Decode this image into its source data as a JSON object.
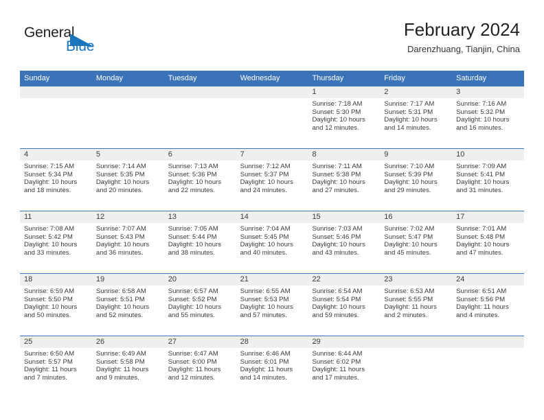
{
  "brand": {
    "name_top": "General",
    "name_bottom": "Blue",
    "flag_icon": "blue-triangle-flag-icon",
    "flag_color": "#1b75bc",
    "text_color": "#231f20"
  },
  "header": {
    "title": "February 2024",
    "subtitle": "Darenzhuang, Tianjin, China"
  },
  "theme": {
    "header_blue": "#3b73b8",
    "datestrip_gray": "#efeff0",
    "cell_white": "#ffffff",
    "text": "#3a3a3a"
  },
  "calendar": {
    "weekday_headers": [
      "Sunday",
      "Monday",
      "Tuesday",
      "Wednesday",
      "Thursday",
      "Friday",
      "Saturday"
    ],
    "labels": {
      "sunrise": "Sunrise:",
      "sunset": "Sunset:",
      "daylight": "Daylight:"
    },
    "weeks": [
      [
        {
          "day": "",
          "sunrise": "",
          "sunset": "",
          "daylight_line1": "",
          "daylight_line2": ""
        },
        {
          "day": "",
          "sunrise": "",
          "sunset": "",
          "daylight_line1": "",
          "daylight_line2": ""
        },
        {
          "day": "",
          "sunrise": "",
          "sunset": "",
          "daylight_line1": "",
          "daylight_line2": ""
        },
        {
          "day": "",
          "sunrise": "",
          "sunset": "",
          "daylight_line1": "",
          "daylight_line2": ""
        },
        {
          "day": "1",
          "sunrise": "Sunrise: 7:18 AM",
          "sunset": "Sunset: 5:30 PM",
          "daylight_line1": "Daylight: 10 hours",
          "daylight_line2": "and 12 minutes."
        },
        {
          "day": "2",
          "sunrise": "Sunrise: 7:17 AM",
          "sunset": "Sunset: 5:31 PM",
          "daylight_line1": "Daylight: 10 hours",
          "daylight_line2": "and 14 minutes."
        },
        {
          "day": "3",
          "sunrise": "Sunrise: 7:16 AM",
          "sunset": "Sunset: 5:32 PM",
          "daylight_line1": "Daylight: 10 hours",
          "daylight_line2": "and 16 minutes."
        }
      ],
      [
        {
          "day": "4",
          "sunrise": "Sunrise: 7:15 AM",
          "sunset": "Sunset: 5:34 PM",
          "daylight_line1": "Daylight: 10 hours",
          "daylight_line2": "and 18 minutes."
        },
        {
          "day": "5",
          "sunrise": "Sunrise: 7:14 AM",
          "sunset": "Sunset: 5:35 PM",
          "daylight_line1": "Daylight: 10 hours",
          "daylight_line2": "and 20 minutes."
        },
        {
          "day": "6",
          "sunrise": "Sunrise: 7:13 AM",
          "sunset": "Sunset: 5:36 PM",
          "daylight_line1": "Daylight: 10 hours",
          "daylight_line2": "and 22 minutes."
        },
        {
          "day": "7",
          "sunrise": "Sunrise: 7:12 AM",
          "sunset": "Sunset: 5:37 PM",
          "daylight_line1": "Daylight: 10 hours",
          "daylight_line2": "and 24 minutes."
        },
        {
          "day": "8",
          "sunrise": "Sunrise: 7:11 AM",
          "sunset": "Sunset: 5:38 PM",
          "daylight_line1": "Daylight: 10 hours",
          "daylight_line2": "and 27 minutes."
        },
        {
          "day": "9",
          "sunrise": "Sunrise: 7:10 AM",
          "sunset": "Sunset: 5:39 PM",
          "daylight_line1": "Daylight: 10 hours",
          "daylight_line2": "and 29 minutes."
        },
        {
          "day": "10",
          "sunrise": "Sunrise: 7:09 AM",
          "sunset": "Sunset: 5:41 PM",
          "daylight_line1": "Daylight: 10 hours",
          "daylight_line2": "and 31 minutes."
        }
      ],
      [
        {
          "day": "11",
          "sunrise": "Sunrise: 7:08 AM",
          "sunset": "Sunset: 5:42 PM",
          "daylight_line1": "Daylight: 10 hours",
          "daylight_line2": "and 33 minutes."
        },
        {
          "day": "12",
          "sunrise": "Sunrise: 7:07 AM",
          "sunset": "Sunset: 5:43 PM",
          "daylight_line1": "Daylight: 10 hours",
          "daylight_line2": "and 36 minutes."
        },
        {
          "day": "13",
          "sunrise": "Sunrise: 7:05 AM",
          "sunset": "Sunset: 5:44 PM",
          "daylight_line1": "Daylight: 10 hours",
          "daylight_line2": "and 38 minutes."
        },
        {
          "day": "14",
          "sunrise": "Sunrise: 7:04 AM",
          "sunset": "Sunset: 5:45 PM",
          "daylight_line1": "Daylight: 10 hours",
          "daylight_line2": "and 40 minutes."
        },
        {
          "day": "15",
          "sunrise": "Sunrise: 7:03 AM",
          "sunset": "Sunset: 5:46 PM",
          "daylight_line1": "Daylight: 10 hours",
          "daylight_line2": "and 43 minutes."
        },
        {
          "day": "16",
          "sunrise": "Sunrise: 7:02 AM",
          "sunset": "Sunset: 5:47 PM",
          "daylight_line1": "Daylight: 10 hours",
          "daylight_line2": "and 45 minutes."
        },
        {
          "day": "17",
          "sunrise": "Sunrise: 7:01 AM",
          "sunset": "Sunset: 5:48 PM",
          "daylight_line1": "Daylight: 10 hours",
          "daylight_line2": "and 47 minutes."
        }
      ],
      [
        {
          "day": "18",
          "sunrise": "Sunrise: 6:59 AM",
          "sunset": "Sunset: 5:50 PM",
          "daylight_line1": "Daylight: 10 hours",
          "daylight_line2": "and 50 minutes."
        },
        {
          "day": "19",
          "sunrise": "Sunrise: 6:58 AM",
          "sunset": "Sunset: 5:51 PM",
          "daylight_line1": "Daylight: 10 hours",
          "daylight_line2": "and 52 minutes."
        },
        {
          "day": "20",
          "sunrise": "Sunrise: 6:57 AM",
          "sunset": "Sunset: 5:52 PM",
          "daylight_line1": "Daylight: 10 hours",
          "daylight_line2": "and 55 minutes."
        },
        {
          "day": "21",
          "sunrise": "Sunrise: 6:55 AM",
          "sunset": "Sunset: 5:53 PM",
          "daylight_line1": "Daylight: 10 hours",
          "daylight_line2": "and 57 minutes."
        },
        {
          "day": "22",
          "sunrise": "Sunrise: 6:54 AM",
          "sunset": "Sunset: 5:54 PM",
          "daylight_line1": "Daylight: 10 hours",
          "daylight_line2": "and 59 minutes."
        },
        {
          "day": "23",
          "sunrise": "Sunrise: 6:53 AM",
          "sunset": "Sunset: 5:55 PM",
          "daylight_line1": "Daylight: 11 hours",
          "daylight_line2": "and 2 minutes."
        },
        {
          "day": "24",
          "sunrise": "Sunrise: 6:51 AM",
          "sunset": "Sunset: 5:56 PM",
          "daylight_line1": "Daylight: 11 hours",
          "daylight_line2": "and 4 minutes."
        }
      ],
      [
        {
          "day": "25",
          "sunrise": "Sunrise: 6:50 AM",
          "sunset": "Sunset: 5:57 PM",
          "daylight_line1": "Daylight: 11 hours",
          "daylight_line2": "and 7 minutes."
        },
        {
          "day": "26",
          "sunrise": "Sunrise: 6:49 AM",
          "sunset": "Sunset: 5:58 PM",
          "daylight_line1": "Daylight: 11 hours",
          "daylight_line2": "and 9 minutes."
        },
        {
          "day": "27",
          "sunrise": "Sunrise: 6:47 AM",
          "sunset": "Sunset: 6:00 PM",
          "daylight_line1": "Daylight: 11 hours",
          "daylight_line2": "and 12 minutes."
        },
        {
          "day": "28",
          "sunrise": "Sunrise: 6:46 AM",
          "sunset": "Sunset: 6:01 PM",
          "daylight_line1": "Daylight: 11 hours",
          "daylight_line2": "and 14 minutes."
        },
        {
          "day": "29",
          "sunrise": "Sunrise: 6:44 AM",
          "sunset": "Sunset: 6:02 PM",
          "daylight_line1": "Daylight: 11 hours",
          "daylight_line2": "and 17 minutes."
        },
        {
          "day": "",
          "sunrise": "",
          "sunset": "",
          "daylight_line1": "",
          "daylight_line2": ""
        },
        {
          "day": "",
          "sunrise": "",
          "sunset": "",
          "daylight_line1": "",
          "daylight_line2": ""
        }
      ]
    ]
  }
}
